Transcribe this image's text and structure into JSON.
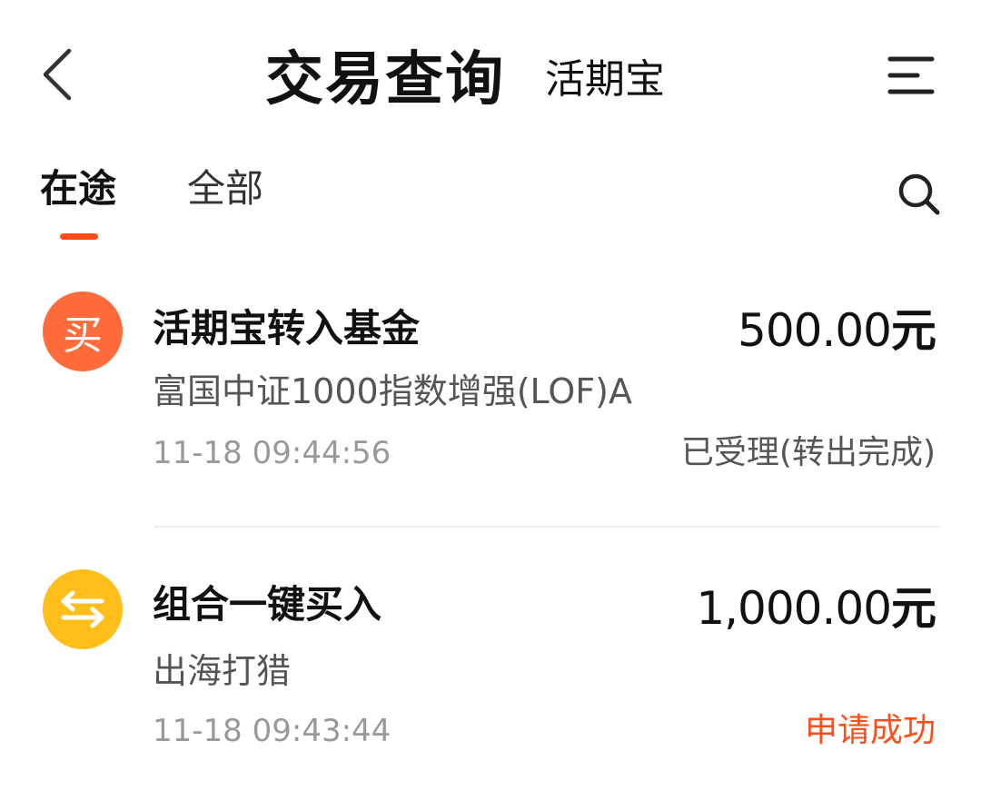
{
  "header": {
    "title": "交易查询",
    "subtitle": "活期宝"
  },
  "tabs": [
    {
      "label": "在途",
      "active": true
    },
    {
      "label": "全部",
      "active": false
    }
  ],
  "records": [
    {
      "icon": "buy-icon",
      "icon_text": "买",
      "icon_color": "#ff6b3a",
      "title": "活期宝转入基金",
      "amount": "500.00",
      "unit": "元",
      "subtitle": "富国中证1000指数增强(LOF)A",
      "time": "11-18 09:44:56",
      "status": "已受理(转出完成)"
    },
    {
      "icon": "exchange-icon",
      "icon_color": "#ffbe1a",
      "title": "组合一键买入",
      "amount": "1,000.00",
      "unit": "元",
      "subtitle": "出海打猎",
      "time": "11-18 09:43:44",
      "status": "申请成功",
      "status_color": "#ff4e1a"
    }
  ],
  "colors": {
    "accent": "#ff4e1a",
    "text_primary": "#111111",
    "text_secondary": "#555555",
    "text_muted": "#999999"
  }
}
